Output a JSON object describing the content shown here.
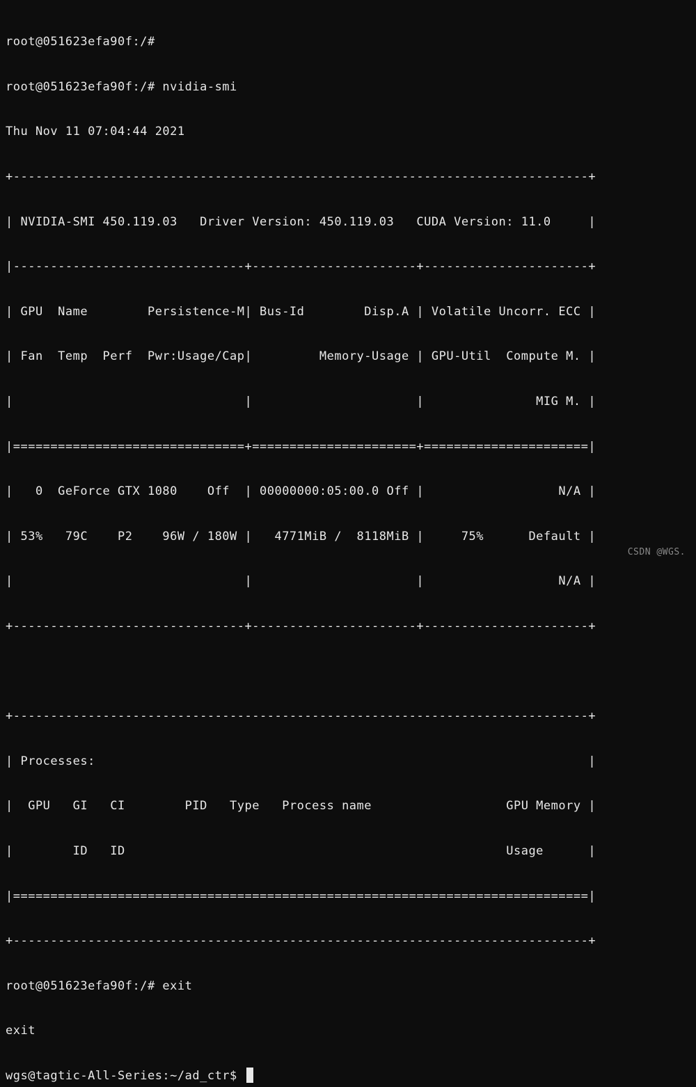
{
  "lines": {
    "l1": "root@051623efa90f:/#",
    "l2": "root@051623efa90f:/# nvidia-smi",
    "l3": "Thu Nov 11 07:04:44 2021",
    "l4": "+-----------------------------------------------------------------------------+",
    "l5": "| NVIDIA-SMI 450.119.03   Driver Version: 450.119.03   CUDA Version: 11.0     |",
    "l6": "|-------------------------------+----------------------+----------------------+",
    "l7": "| GPU  Name        Persistence-M| Bus-Id        Disp.A | Volatile Uncorr. ECC |",
    "l8": "| Fan  Temp  Perf  Pwr:Usage/Cap|         Memory-Usage | GPU-Util  Compute M. |",
    "l9": "|                               |                      |               MIG M. |",
    "l10": "|===============================+======================+======================|",
    "l11": "|   0  GeForce GTX 1080    Off  | 00000000:05:00.0 Off |                  N/A |",
    "l12": "| 53%   79C    P2    96W / 180W |   4771MiB /  8118MiB |     75%      Default |",
    "l13": "|                               |                      |                  N/A |",
    "l14": "+-------------------------------+----------------------+----------------------+",
    "l15": "                                                                               ",
    "l16": "+-----------------------------------------------------------------------------+",
    "l17": "| Processes:                                                                  |",
    "l18": "|  GPU   GI   CI        PID   Type   Process name                  GPU Memory |",
    "l19": "|        ID   ID                                                   Usage      |",
    "l20": "|=============================================================================|",
    "l21": "+-----------------------------------------------------------------------------+",
    "l22": "root@051623efa90f:/# exit",
    "l23": "exit",
    "l24": "wgs@tagtic-All-Series:~/ad_ctr$ "
  },
  "watermark": "CSDN @WGS."
}
